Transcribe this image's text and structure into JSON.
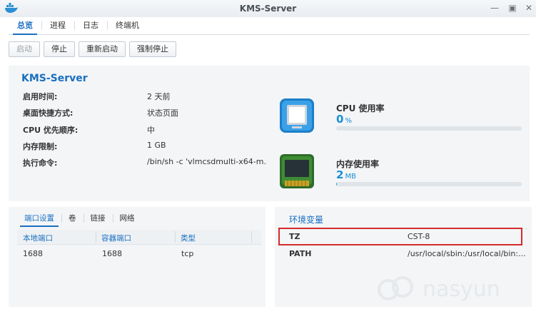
{
  "window": {
    "title": "KMS-Server"
  },
  "tabs": [
    {
      "label": "总览",
      "active": true
    },
    {
      "label": "进程",
      "active": false
    },
    {
      "label": "日志",
      "active": false
    },
    {
      "label": "终端机",
      "active": false
    }
  ],
  "toolbar": {
    "start_label": "启动",
    "stop_label": "停止",
    "restart_label": "重新启动",
    "force_stop_label": "强制停止"
  },
  "overview": {
    "title": "KMS-Server",
    "rows": [
      {
        "label": "启用时间:",
        "value": "2 天前"
      },
      {
        "label": "桌面快捷方式:",
        "value": "状态页面"
      },
      {
        "label": "CPU 优先顺序:",
        "value": "中"
      },
      {
        "label": "内存限制:",
        "value": "1 GB"
      },
      {
        "label": "执行命令:",
        "value": "/bin/sh -c 'vlmcsdmulti-x64-m..."
      }
    ],
    "cpu": {
      "title": "CPU 使用率",
      "value": "0",
      "unit": "%",
      "percent": 0,
      "icon": "cpu-chip-icon"
    },
    "memory": {
      "title": "内存使用率",
      "value": "2",
      "unit": "MB",
      "percent": 0.2,
      "icon": "memory-module-icon"
    }
  },
  "ports": {
    "subtabs": [
      {
        "label": "端口设置",
        "active": true
      },
      {
        "label": "卷",
        "active": false
      },
      {
        "label": "链接",
        "active": false
      },
      {
        "label": "网络",
        "active": false
      }
    ],
    "columns": [
      "本地端口",
      "容器端口",
      "类型"
    ],
    "rows": [
      [
        "1688",
        "1688",
        "tcp"
      ]
    ]
  },
  "env": {
    "title": "环境变量",
    "rows": [
      {
        "key": "TZ",
        "value": "CST-8",
        "highlighted": true
      },
      {
        "key": "PATH",
        "value": "/usr/local/sbin:/usr/local/bin:..."
      }
    ]
  },
  "watermark": {
    "text": "nasyun"
  },
  "colors": {
    "accent": "#1a6fc0",
    "meter": "#1b8fd6",
    "highlight_border": "#d42b2b",
    "panel_bg": "#f3f5f7"
  }
}
